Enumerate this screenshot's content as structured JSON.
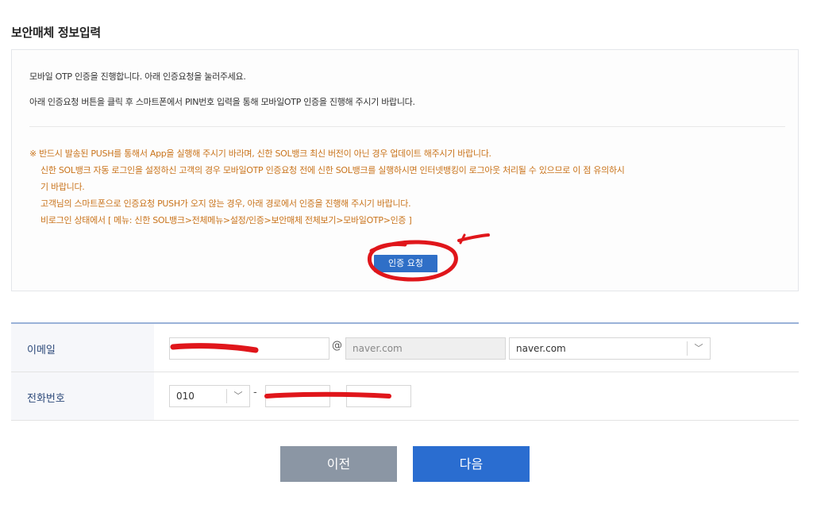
{
  "section_title": "보안매체 정보입력",
  "info": {
    "line1": "모바일 OTP 인증을 진행합니다. 아래 인증요청을 눌러주세요.",
    "line2": "아래 인증요청 버튼을 클릭 후 스마트폰에서 PIN번호 입력을 통해 모바일OTP 인증을 진행해 주시기 바랍니다."
  },
  "notice": {
    "line1": "※ 반드시 발송된 PUSH를 통해서 App을 실행해 주시기 바라며, 신한 SOL뱅크 최신 버전이 아닌 경우 업데이트 해주시기 바랍니다.",
    "line2": "신한 SOL뱅크 자동 로그인을 설정하신 고객의 경우 모바일OTP 인증요청 전에 신한 SOL뱅크를 실행하시면 인터넷뱅킹이 로그아웃 처리될 수 있으므로 이 점 유의하시",
    "line3": "기 바랍니다.",
    "line4": "고객님의 스마트폰으로 인증요청 PUSH가 오지 않는 경우, 아래 경로에서 인증을 진행해 주시기 바랍니다.",
    "line5": "비로그인 상태에서 [ 메뉴: 신한 SOL뱅크>전체메뉴>설정/인증>보안매체 전체보기>모바일OTP>인증 ]"
  },
  "auth_button_label": "인증 요청",
  "form": {
    "email_label": "이메일",
    "email_local_value": "",
    "email_at": "@",
    "email_domain_value": "naver.com",
    "email_domain_select": "naver.com",
    "phone_label": "전화번호",
    "phone_prefix": "010",
    "phone_dash": "-",
    "phone_mid_value": "",
    "phone_last_value": ""
  },
  "buttons": {
    "prev": "이전",
    "next": "다음"
  },
  "colors": {
    "notice_text": "#c9741c",
    "primary_button": "#2a6dd0",
    "secondary_button": "#8b96a4",
    "annotation_red": "#e0161b"
  },
  "icons": {
    "select_arrow": "chevron-down-icon"
  }
}
